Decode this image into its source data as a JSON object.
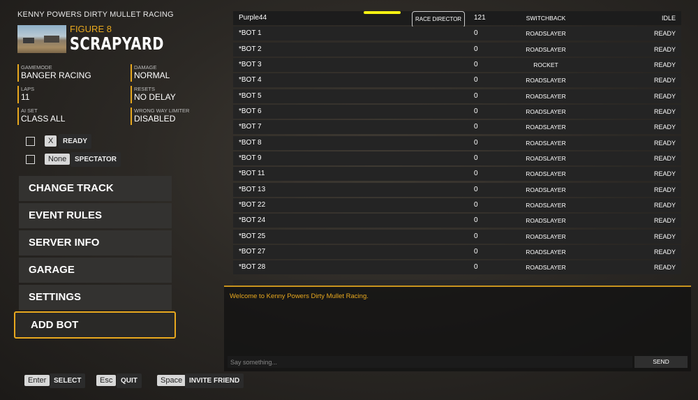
{
  "server": {
    "name": "KENNY POWERS DIRTY MULLET RACING"
  },
  "map": {
    "subtitle": "FIGURE 8",
    "title": "SCRAPYARD"
  },
  "settings": [
    {
      "label": "GAMEMODE",
      "value": "BANGER RACING"
    },
    {
      "label": "DAMAGE",
      "value": "NORMAL"
    },
    {
      "label": "LAPS",
      "value": "11"
    },
    {
      "label": "RESETS",
      "value": "NO DELAY"
    },
    {
      "label": "AI SET",
      "value": "CLASS ALL"
    },
    {
      "label": "WRONG WAY LIMITER",
      "value": "DISABLED"
    }
  ],
  "toggles": [
    {
      "key": "X",
      "label": "READY"
    },
    {
      "key": "None",
      "label": "SPECTATOR"
    }
  ],
  "menu": [
    "CHANGE TRACK",
    "EVENT RULES",
    "SERVER INFO",
    "GARAGE",
    "SETTINGS",
    "ADD BOT"
  ],
  "players": [
    {
      "name": "Purple44",
      "role": "RACE DIRECTOR",
      "num": "121",
      "car": "SWITCHBACK",
      "status": "IDLE"
    },
    {
      "name": "*BOT 1",
      "num": "0",
      "car": "ROADSLAYER",
      "status": "READY"
    },
    {
      "name": "*BOT 2",
      "num": "0",
      "car": "ROADSLAYER",
      "status": "READY"
    },
    {
      "name": "*BOT 3",
      "num": "0",
      "car": "ROCKET",
      "status": "READY"
    },
    {
      "name": "*BOT 4",
      "num": "0",
      "car": "ROADSLAYER",
      "status": "READY"
    },
    {
      "name": "*BOT 5",
      "num": "0",
      "car": "ROADSLAYER",
      "status": "READY"
    },
    {
      "name": "*BOT 6",
      "num": "0",
      "car": "ROADSLAYER",
      "status": "READY"
    },
    {
      "name": "*BOT 7",
      "num": "0",
      "car": "ROADSLAYER",
      "status": "READY"
    },
    {
      "name": "*BOT 8",
      "num": "0",
      "car": "ROADSLAYER",
      "status": "READY"
    },
    {
      "name": "*BOT 9",
      "num": "0",
      "car": "ROADSLAYER",
      "status": "READY"
    },
    {
      "name": "*BOT 11",
      "num": "0",
      "car": "ROADSLAYER",
      "status": "READY"
    },
    {
      "name": "*BOT 13",
      "num": "0",
      "car": "ROADSLAYER",
      "status": "READY"
    },
    {
      "name": "*BOT 22",
      "num": "0",
      "car": "ROADSLAYER",
      "status": "READY"
    },
    {
      "name": "*BOT 24",
      "num": "0",
      "car": "ROADSLAYER",
      "status": "READY"
    },
    {
      "name": "*BOT 25",
      "num": "0",
      "car": "ROADSLAYER",
      "status": "READY"
    },
    {
      "name": "*BOT 27",
      "num": "0",
      "car": "ROADSLAYER",
      "status": "READY"
    },
    {
      "name": "*BOT 28",
      "num": "0",
      "car": "ROADSLAYER",
      "status": "READY"
    }
  ],
  "chat": {
    "welcome": "Welcome to Kenny Powers Dirty Mullet Racing.",
    "placeholder": "Say something...",
    "send": "SEND"
  },
  "hints": [
    {
      "key": "Enter",
      "label": "SELECT"
    },
    {
      "key": "Esc",
      "label": "QUIT"
    },
    {
      "key": "Space",
      "label": "INVITE FRIEND"
    }
  ],
  "colors": {
    "accent": "#e8a81e",
    "highlight": "#f7f212"
  }
}
